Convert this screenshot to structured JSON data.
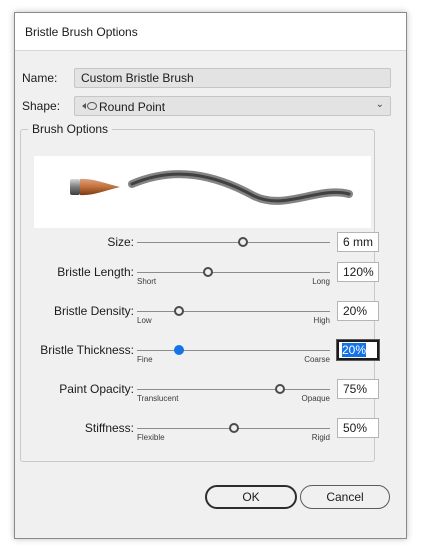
{
  "dialog": {
    "title": "Bristle Brush Options"
  },
  "name_field": {
    "label": "Name:",
    "value": "Custom Bristle Brush"
  },
  "shape_field": {
    "label": "Shape:",
    "value": "Round Point",
    "icon": "round-point-brush-icon"
  },
  "brush_options": {
    "legend": "Brush Options",
    "preview_icon": "brush-stroke-preview-icon",
    "sliders": [
      {
        "label": "Size:",
        "min_label": "",
        "max_label": "",
        "value_text": "6 mm",
        "position_pct": 55,
        "active": false,
        "focused": false
      },
      {
        "label": "Bristle Length:",
        "min_label": "Short",
        "max_label": "Long",
        "value_text": "120%",
        "position_pct": 37,
        "active": false,
        "focused": false
      },
      {
        "label": "Bristle Density:",
        "min_label": "Low",
        "max_label": "High",
        "value_text": "20%",
        "position_pct": 22,
        "active": false,
        "focused": false
      },
      {
        "label": "Bristle Thickness:",
        "min_label": "Fine",
        "max_label": "Coarse",
        "value_text": "20%",
        "position_pct": 22,
        "active": true,
        "focused": true
      },
      {
        "label": "Paint Opacity:",
        "min_label": "Translucent",
        "max_label": "Opaque",
        "value_text": "75%",
        "position_pct": 74,
        "active": false,
        "focused": false
      },
      {
        "label": "Stiffness:",
        "min_label": "Flexible",
        "max_label": "Rigid",
        "value_text": "50%",
        "position_pct": 50,
        "active": false,
        "focused": false
      }
    ]
  },
  "buttons": {
    "ok": "OK",
    "cancel": "Cancel"
  },
  "colors": {
    "accent": "#1473e6",
    "panel": "#f0f0f0"
  }
}
